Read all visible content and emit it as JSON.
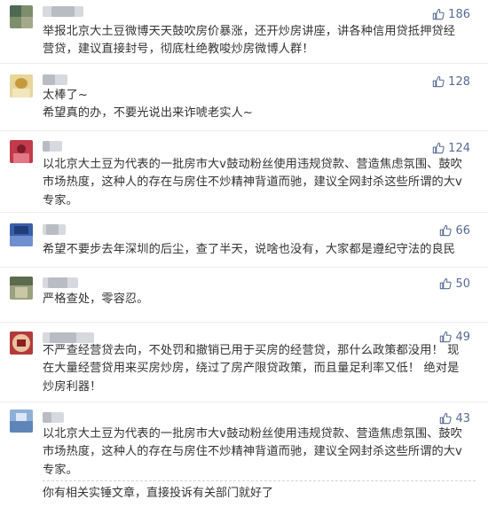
{
  "comments": [
    {
      "likes": "186",
      "lines": [
        "举报北京大土豆微博天天鼓吹房价暴涨，还开炒房讲座，讲各种信用贷抵押贷经",
        "营贷，建议直接封号，彻底杜绝教唆炒房微博人群！"
      ]
    },
    {
      "likes": "128",
      "lines": [
        "太棒了~",
        "希望真的办，不要光说出来诈唬老实人~"
      ]
    },
    {
      "likes": "124",
      "lines": [
        "以北京大土豆为代表的一批房市大v鼓动粉丝使用违规贷款、营造焦虑氛围、鼓吹",
        "市场热度，这种人的存在与房住不炒精神背道而驰，建议全网封杀这些所谓的大v",
        "专家。"
      ]
    },
    {
      "likes": "66",
      "lines": [
        "希望不要步去年深圳的后尘，查了半天，说啥也没有，大家都是遵纪守法的良民"
      ]
    },
    {
      "likes": "50",
      "lines": [
        "严格查处，零容忍。"
      ]
    },
    {
      "likes": "49",
      "lines": [
        "不严查经营贷去向，不处罚和撤销已用于买房的经营贷，那什么政策都没用！ 现",
        "在大量经营贷用来买房炒房，绕过了房产限贷政策，而且量足利率又低！ 绝对是",
        "炒房利器！"
      ]
    },
    {
      "likes": "43",
      "lines": [
        "以北京大土豆为代表的一批房市大v鼓动粉丝使用违规贷款、营造焦虑氛围、鼓吹",
        "市场热度，这种人的存在与房住不炒精神背道而驰，建议全网封杀这些所谓的大v",
        "专家。"
      ],
      "reply": "你有相关实锤文章，直接投诉有关部门就好了"
    }
  ],
  "colors": {
    "like": "#576b95",
    "text": "#333333",
    "divider": "#ececec"
  }
}
